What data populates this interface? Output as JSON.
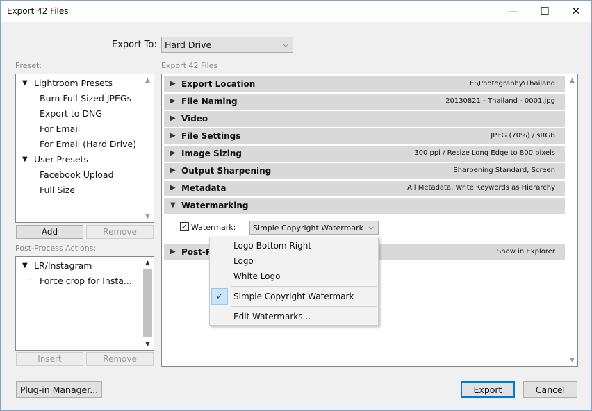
{
  "window": {
    "title": "Export 42 Files",
    "minimize": "—",
    "maximize": "☐",
    "close": "✕"
  },
  "export_to": {
    "label": "Export To:",
    "value": "Hard Drive"
  },
  "preset": {
    "label": "Preset:",
    "groups": [
      {
        "name": "Lightroom Presets",
        "items": [
          "Burn Full-Sized JPEGs",
          "Export to DNG",
          "For Email",
          "For Email (Hard Drive)"
        ]
      },
      {
        "name": "User Presets",
        "items": [
          "Facebook Upload",
          "Full Size"
        ]
      }
    ],
    "add_label": "Add",
    "remove_label": "Remove"
  },
  "post_process": {
    "label": "Post-Process Actions:",
    "group": "LR/Instagram",
    "item": "Force crop for Insta...",
    "insert_label": "Insert",
    "remove_label": "Remove"
  },
  "export_files_label": "Export 42 Files",
  "sections": [
    {
      "name": "Export Location",
      "value": "E:\\Photography\\Thailand",
      "expanded": false
    },
    {
      "name": "File Naming",
      "value": "20130821 - Thailand - 0001.jpg",
      "expanded": false
    },
    {
      "name": "Video",
      "value": "",
      "expanded": false
    },
    {
      "name": "File Settings",
      "value": "JPEG (70%) / sRGB",
      "expanded": false
    },
    {
      "name": "Image Sizing",
      "value": "300 ppi / Resize Long Edge to 800 pixels",
      "expanded": false
    },
    {
      "name": "Output Sharpening",
      "value": "Sharpening Standard, Screen",
      "expanded": false
    },
    {
      "name": "Metadata",
      "value": "All Metadata, Write Keywords as Hierarchy",
      "expanded": false
    },
    {
      "name": "Watermarking",
      "value": "",
      "expanded": true
    },
    {
      "name": "Post-Pr",
      "value": "Show in Explorer",
      "expanded": false
    }
  ],
  "watermark": {
    "label": "Watermark:",
    "checked": true,
    "value": "Simple Copyright Watermark"
  },
  "watermark_menu": {
    "items": [
      "Logo Bottom Right",
      "Logo",
      "White Logo"
    ],
    "selected": "Simple Copyright Watermark",
    "edit": "Edit Watermarks..."
  },
  "footer": {
    "plugin_manager": "Plug-in Manager...",
    "export": "Export",
    "cancel": "Cancel"
  }
}
